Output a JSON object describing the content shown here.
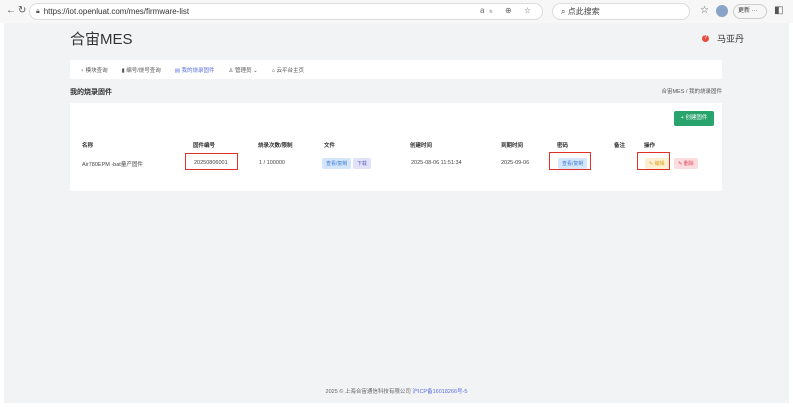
{
  "browser": {
    "url": "https://iot.openluat.com/mes/firmware-list",
    "search_placeholder": "点此搜索",
    "update_label": "更新"
  },
  "header": {
    "brand": "合宙MES",
    "user": "马亚丹"
  },
  "nav": [
    {
      "label": "模块查询",
      "icon": "lightbulb-icon"
    },
    {
      "label": "编号/烧号查询",
      "icon": "phone-icon"
    },
    {
      "label": "我的烧录固件",
      "icon": "file-icon",
      "active": true
    },
    {
      "label": "管理员",
      "icon": "user-icon"
    },
    {
      "label": "云平台主页",
      "icon": "home-icon"
    }
  ],
  "page": {
    "title": "我的烧录固件",
    "breadcrumb": [
      "合宙MES",
      "我的烧录固件"
    ],
    "create_label": "+ 创建固件"
  },
  "table": {
    "headers": [
      "名称",
      "固件编号",
      "烧录次数/限制",
      "文件",
      "创建时间",
      "到期时间",
      "密码",
      "备注",
      "操作"
    ],
    "rows": [
      {
        "name": "Air780EPM -bat量产固件",
        "id": "20250806001",
        "count": "1 / 100000",
        "file_view": "查看/复制",
        "file_download": "下载",
        "created": "2025-08-06 11:51:34",
        "expires": "2025-09-06",
        "password": "查看/复制",
        "note": "",
        "edit": "编辑",
        "delete": "删除"
      }
    ]
  },
  "footer": {
    "text": "2025 © 上海合宙通信科技有限公司",
    "icp": "沪ICP备16018266号-5"
  }
}
